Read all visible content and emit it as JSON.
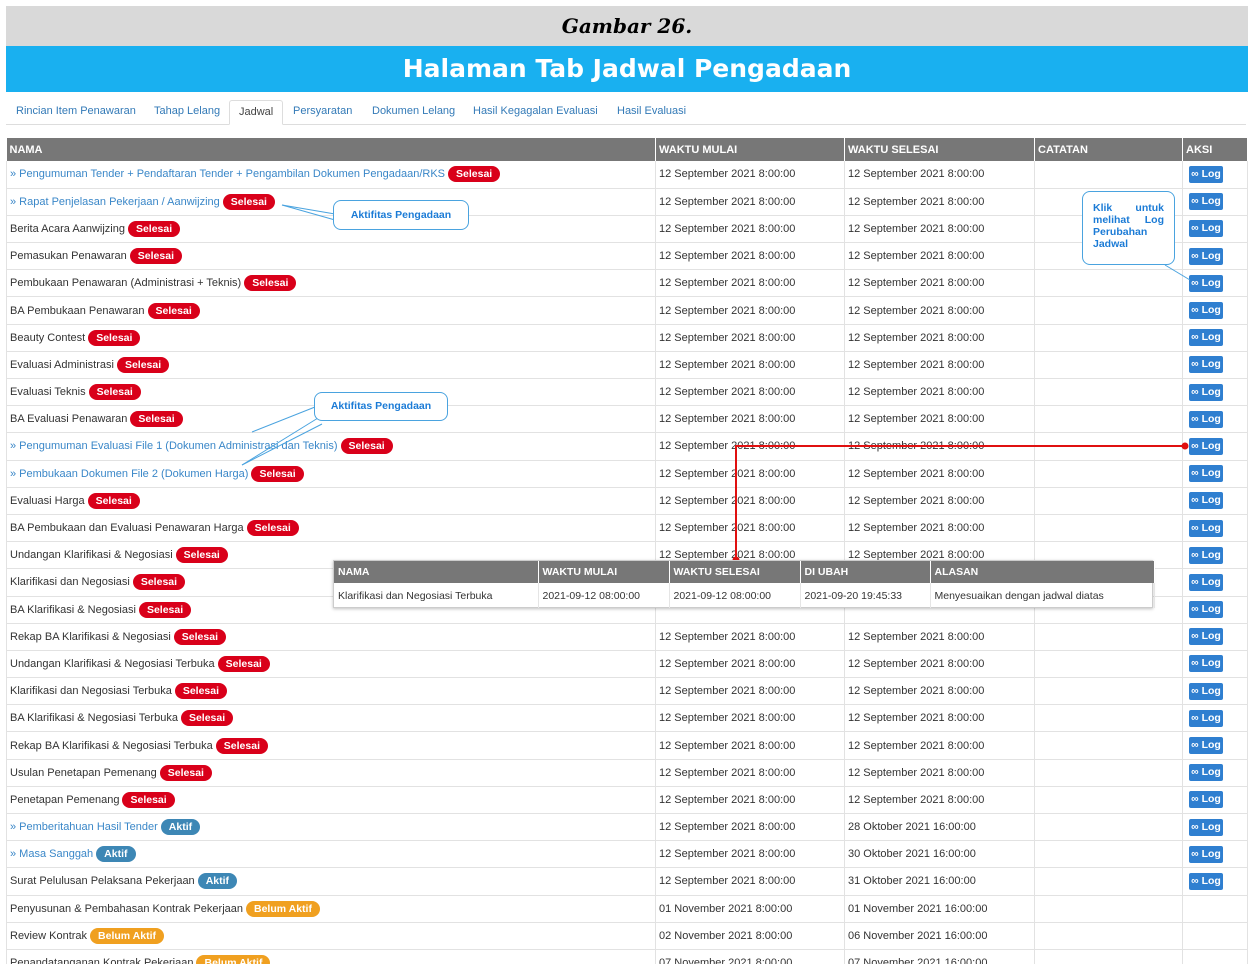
{
  "figure_caption": "Gambar 26.",
  "page_heading": "Halaman Tab Jadwal Pengadaan",
  "tabs": [
    "Rincian Item Penawaran",
    "Tahap Lelang",
    "Jadwal",
    "Persyaratan",
    "Dokumen Lelang",
    "Hasil Kegagalan Evaluasi",
    "Hasil Evaluasi"
  ],
  "active_tab": "Jadwal",
  "table": {
    "headers": {
      "nama": "NAMA",
      "mulai": "WAKTU MULAI",
      "selesai": "WAKTU SELESAI",
      "catatan": "CATATAN",
      "aksi": "AKSI"
    },
    "log_label": "Log",
    "rows": [
      {
        "name": "» Pengumuman Tender + Pendaftaran Tender + Pengambilan Dokumen Pengadaan/RKS",
        "link": true,
        "status": "Selesai",
        "mulai": "12 September 2021 8:00:00",
        "selesai": "12 September 2021 8:00:00",
        "log": true
      },
      {
        "name": "» Rapat Penjelasan Pekerjaan / Aanwijzing",
        "link": true,
        "status": "Selesai",
        "mulai": "12 September 2021 8:00:00",
        "selesai": "12 September 2021 8:00:00",
        "log": true
      },
      {
        "name": "Berita Acara Aanwijzing",
        "link": false,
        "status": "Selesai",
        "mulai": "12 September 2021 8:00:00",
        "selesai": "12 September 2021 8:00:00",
        "log": true
      },
      {
        "name": "Pemasukan Penawaran",
        "link": false,
        "status": "Selesai",
        "mulai": "12 September 2021 8:00:00",
        "selesai": "12 September 2021 8:00:00",
        "log": true
      },
      {
        "name": "Pembukaan Penawaran (Administrasi + Teknis)",
        "link": false,
        "status": "Selesai",
        "mulai": "12 September 2021 8:00:00",
        "selesai": "12 September 2021 8:00:00",
        "log": true
      },
      {
        "name": "BA Pembukaan Penawaran",
        "link": false,
        "status": "Selesai",
        "mulai": "12 September 2021 8:00:00",
        "selesai": "12 September 2021 8:00:00",
        "log": true
      },
      {
        "name": "Beauty Contest",
        "link": false,
        "status": "Selesai",
        "mulai": "12 September 2021 8:00:00",
        "selesai": "12 September 2021 8:00:00",
        "log": true
      },
      {
        "name": "Evaluasi Administrasi",
        "link": false,
        "status": "Selesai",
        "mulai": "12 September 2021 8:00:00",
        "selesai": "12 September 2021 8:00:00",
        "log": true
      },
      {
        "name": "Evaluasi Teknis",
        "link": false,
        "status": "Selesai",
        "mulai": "12 September 2021 8:00:00",
        "selesai": "12 September 2021 8:00:00",
        "log": true
      },
      {
        "name": "BA Evaluasi Penawaran",
        "link": false,
        "status": "Selesai",
        "mulai": "12 September 2021 8:00:00",
        "selesai": "12 September 2021 8:00:00",
        "log": true
      },
      {
        "name": "» Pengumuman Evaluasi File 1 (Dokumen Administrasi dan Teknis)",
        "link": true,
        "status": "Selesai",
        "mulai": "12 September 2021 8:00:00",
        "selesai": "12 September 2021 8:00:00",
        "log": true
      },
      {
        "name": "» Pembukaan Dokumen File 2 (Dokumen Harga)",
        "link": true,
        "status": "Selesai",
        "mulai": "12 September 2021 8:00:00",
        "selesai": "12 September 2021 8:00:00",
        "log": true
      },
      {
        "name": "Evaluasi Harga",
        "link": false,
        "status": "Selesai",
        "mulai": "12 September 2021 8:00:00",
        "selesai": "12 September 2021 8:00:00",
        "log": true
      },
      {
        "name": "BA Pembukaan dan Evaluasi Penawaran Harga",
        "link": false,
        "status": "Selesai",
        "mulai": "12 September 2021 8:00:00",
        "selesai": "12 September 2021 8:00:00",
        "log": true
      },
      {
        "name": "Undangan Klarifikasi & Negosiasi",
        "link": false,
        "status": "Selesai",
        "mulai": "12 September 2021 8:00:00",
        "selesai": "12 September 2021 8:00:00",
        "log": true
      },
      {
        "name": "Klarifikasi dan Negosiasi",
        "link": false,
        "status": "Selesai",
        "mulai": "",
        "selesai": "",
        "log": true
      },
      {
        "name": "BA Klarifikasi & Negosiasi",
        "link": false,
        "status": "Selesai",
        "mulai": "",
        "selesai": "",
        "log": true
      },
      {
        "name": "Rekap BA Klarifikasi & Negosiasi",
        "link": false,
        "status": "Selesai",
        "mulai": "12 September 2021 8:00:00",
        "selesai": "12 September 2021 8:00:00",
        "log": true
      },
      {
        "name": "Undangan Klarifikasi & Negosiasi Terbuka",
        "link": false,
        "status": "Selesai",
        "mulai": "12 September 2021 8:00:00",
        "selesai": "12 September 2021 8:00:00",
        "log": true
      },
      {
        "name": "Klarifikasi dan Negosiasi Terbuka",
        "link": false,
        "status": "Selesai",
        "mulai": "12 September 2021 8:00:00",
        "selesai": "12 September 2021 8:00:00",
        "log": true
      },
      {
        "name": "BA Klarifikasi & Negosiasi Terbuka",
        "link": false,
        "status": "Selesai",
        "mulai": "12 September 2021 8:00:00",
        "selesai": "12 September 2021 8:00:00",
        "log": true
      },
      {
        "name": "Rekap BA Klarifikasi & Negosiasi Terbuka",
        "link": false,
        "status": "Selesai",
        "mulai": "12 September 2021 8:00:00",
        "selesai": "12 September 2021 8:00:00",
        "log": true
      },
      {
        "name": "Usulan Penetapan Pemenang",
        "link": false,
        "status": "Selesai",
        "mulai": "12 September 2021 8:00:00",
        "selesai": "12 September 2021 8:00:00",
        "log": true
      },
      {
        "name": "Penetapan Pemenang",
        "link": false,
        "status": "Selesai",
        "mulai": "12 September 2021 8:00:00",
        "selesai": "12 September 2021 8:00:00",
        "log": true
      },
      {
        "name": "» Pemberitahuan Hasil Tender",
        "link": true,
        "status": "Aktif",
        "mulai": "12 September 2021 8:00:00",
        "selesai": "28 Oktober 2021 16:00:00",
        "log": true
      },
      {
        "name": "» Masa Sanggah",
        "link": true,
        "status": "Aktif",
        "mulai": "12 September 2021 8:00:00",
        "selesai": "30 Oktober 2021 16:00:00",
        "log": true
      },
      {
        "name": "Surat Pelulusan Pelaksana Pekerjaan",
        "link": false,
        "status": "Aktif",
        "mulai": "12 September 2021 8:00:00",
        "selesai": "31 Oktober 2021 16:00:00",
        "log": true
      },
      {
        "name": "Penyusunan & Pembahasan Kontrak Pekerjaan",
        "link": false,
        "status": "Belum Aktif",
        "mulai": "01 November 2021 8:00:00",
        "selesai": "01 November 2021 16:00:00",
        "log": false
      },
      {
        "name": "Review Kontrak",
        "link": false,
        "status": "Belum Aktif",
        "mulai": "02 November 2021 8:00:00",
        "selesai": "06 November 2021 16:00:00",
        "log": false
      },
      {
        "name": "Penandatanganan Kontrak Pekerjaan",
        "link": false,
        "status": "Belum Aktif",
        "mulai": "07 November 2021 8:00:00",
        "selesai": "07 November 2021 16:00:00",
        "log": false
      }
    ]
  },
  "status_colors": {
    "Selesai": "#d9001a",
    "Aktif": "#3d87b5",
    "Belum Aktif": "#f0a020"
  },
  "annotations": {
    "callout_1": "Aktifitas Pengadaan",
    "callout_2": "Aktifitas Pengadaan",
    "note": "Klik untuk melihat Log Perubahan Jadwal"
  },
  "log_popup": {
    "headers": [
      "NAMA",
      "WAKTU MULAI",
      "WAKTU SELESAI",
      "DI UBAH",
      "ALASAN"
    ],
    "row": [
      "Klarifikasi dan Negosiasi Terbuka",
      "2021-09-12 08:00:00",
      "2021-09-12 08:00:00",
      "2021-09-20 19:45:33",
      "Menyesuaikan dengan jadwal diatas"
    ]
  },
  "icons": {
    "log": "rss-icon"
  }
}
